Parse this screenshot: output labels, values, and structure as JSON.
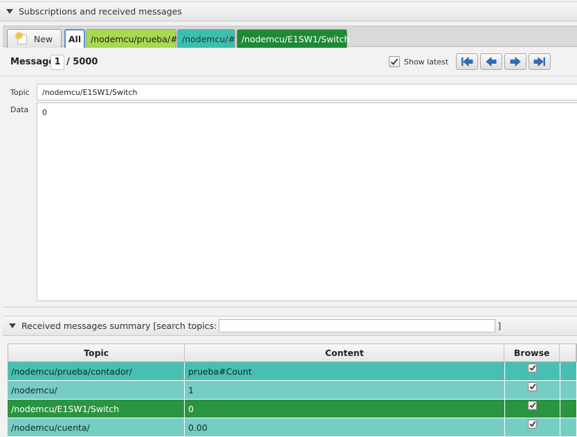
{
  "subscriptions_pane": {
    "title": "Subscriptions and received messages"
  },
  "tabs": {
    "new_label": "New",
    "all_label": "All",
    "topics": [
      "/nodemcu/prueba/#",
      "/nodemcu/#",
      "/nodemcu/E1SW1/Switch"
    ]
  },
  "message_nav": {
    "label": "Message",
    "current": "1",
    "total": "/ 5000",
    "show_latest_label": "Show latest",
    "show_latest_checked": true
  },
  "detail": {
    "topic_label": "Topic",
    "topic_value": "/nodemcu/E1SW1/Switch",
    "data_label": "Data",
    "data_value": "0"
  },
  "summary_pane": {
    "title": "Received messages summary [search topics:",
    "title_close": "]",
    "search_value": ""
  },
  "table": {
    "headers": {
      "topic": "Topic",
      "content": "Content",
      "browse": "Browse"
    },
    "rows": [
      {
        "topic": "/nodemcu/prueba/contador/",
        "content": "prueba#Count",
        "browse": true,
        "color": "#49bfb2"
      },
      {
        "topic": "/nodemcu/",
        "content": "1",
        "browse": true,
        "color": "#75cdc3"
      },
      {
        "topic": "/nodemcu/E1SW1/Switch",
        "content": "0",
        "browse": true,
        "color": "#2b9440"
      },
      {
        "topic": "/nodemcu/cuenta/",
        "content": "0.00",
        "browse": true,
        "color": "#75cdc3"
      }
    ]
  },
  "colors": {
    "tab_topic_1": "#a8d952",
    "tab_topic_2": "#3cbfae",
    "tab_topic_3": "#1f8a36",
    "nav_arrow": "#2f6fbf"
  },
  "icons": {
    "new_tab": "new-document-icon",
    "first": "skip-first-icon",
    "previous": "arrow-left-icon",
    "next": "arrow-right-icon",
    "last": "skip-last-icon",
    "collapse": "triangle-down-icon"
  }
}
